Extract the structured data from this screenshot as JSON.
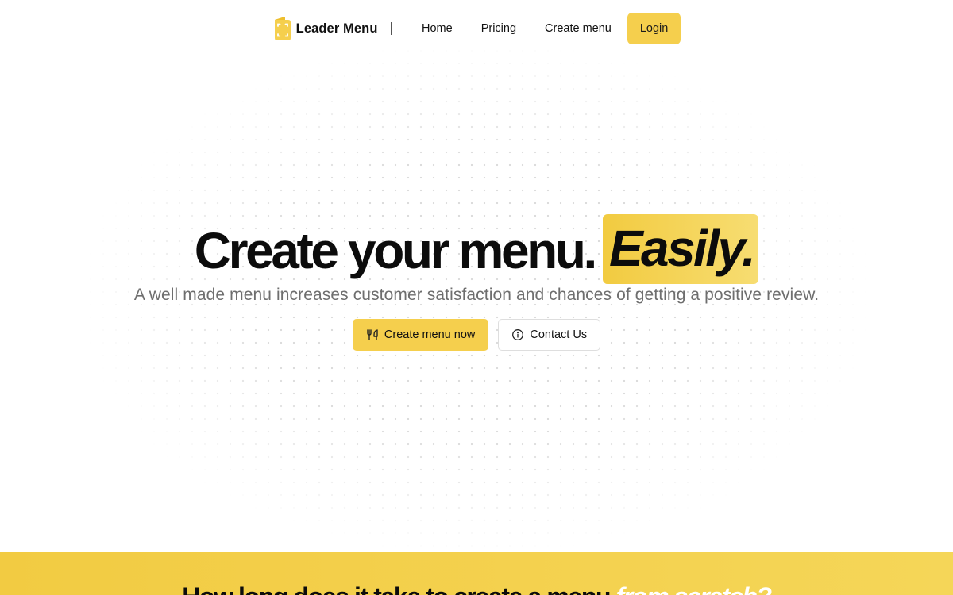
{
  "brand": {
    "name": "Leader Menu",
    "logo_icon": "menu-card-icon"
  },
  "nav": {
    "links": [
      {
        "label": "Home"
      },
      {
        "label": "Pricing"
      },
      {
        "label": "Create menu"
      }
    ],
    "login_label": "Login"
  },
  "hero": {
    "title_plain": "Create your menu.",
    "title_highlight": "Easily.",
    "subtitle": "A well made menu increases customer satisfaction and chances of getting a positive review.",
    "primary_cta": {
      "label": "Create menu now",
      "icon": "fork-knife-icon"
    },
    "secondary_cta": {
      "label": "Contact Us",
      "icon": "info-circle-icon"
    }
  },
  "section": {
    "title_plain": "How long does it take to create a menu ",
    "title_accent": "from scratch?"
  },
  "colors": {
    "accent": "#f5cf4d",
    "text": "#111111",
    "muted": "#6e6e6e"
  }
}
